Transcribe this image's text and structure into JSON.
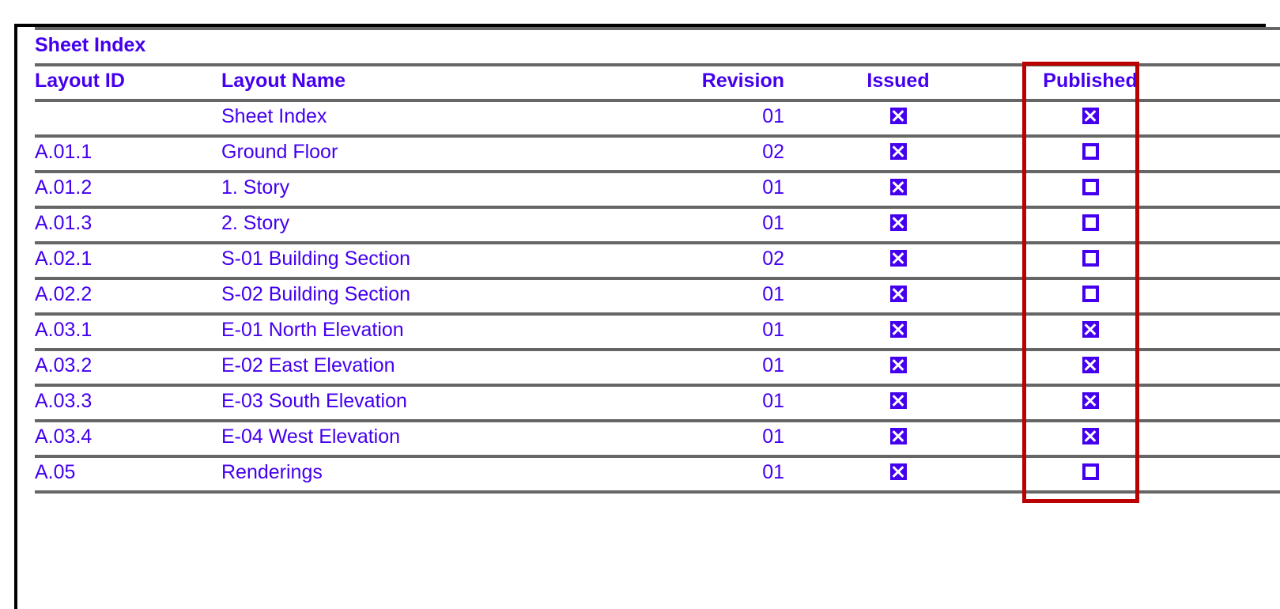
{
  "document": {
    "title": "Sheet Index"
  },
  "table": {
    "columns": [
      {
        "key": "layout_id",
        "label": "Layout ID"
      },
      {
        "key": "layout_name",
        "label": "Layout Name"
      },
      {
        "key": "revision",
        "label": "Revision"
      },
      {
        "key": "issued",
        "label": "Issued"
      },
      {
        "key": "published",
        "label": "Published"
      }
    ],
    "rows": [
      {
        "layout_id": "",
        "layout_name": "Sheet Index",
        "revision": "01",
        "issued": true,
        "published": true
      },
      {
        "layout_id": "A.01.1",
        "layout_name": "Ground Floor",
        "revision": "02",
        "issued": true,
        "published": false
      },
      {
        "layout_id": "A.01.2",
        "layout_name": "1. Story",
        "revision": "01",
        "issued": true,
        "published": false
      },
      {
        "layout_id": "A.01.3",
        "layout_name": "2. Story",
        "revision": "01",
        "issued": true,
        "published": false
      },
      {
        "layout_id": "A.02.1",
        "layout_name": "S-01 Building Section",
        "revision": "02",
        "issued": true,
        "published": false
      },
      {
        "layout_id": "A.02.2",
        "layout_name": "S-02 Building Section",
        "revision": "01",
        "issued": true,
        "published": false
      },
      {
        "layout_id": "A.03.1",
        "layout_name": "E-01 North Elevation",
        "revision": "01",
        "issued": true,
        "published": true
      },
      {
        "layout_id": "A.03.2",
        "layout_name": "E-02 East Elevation",
        "revision": "01",
        "issued": true,
        "published": true
      },
      {
        "layout_id": "A.03.3",
        "layout_name": "E-03 South Elevation",
        "revision": "01",
        "issued": true,
        "published": true
      },
      {
        "layout_id": "A.03.4",
        "layout_name": "E-04 West Elevation",
        "revision": "01",
        "issued": true,
        "published": true
      },
      {
        "layout_id": "A.05",
        "layout_name": "Renderings",
        "revision": "01",
        "issued": true,
        "published": false
      }
    ]
  },
  "annotation": {
    "highlight_target": "Published",
    "highlight_color": "#bb0000"
  },
  "colors": {
    "text": "#4400ee",
    "rule": "#666666",
    "frame": "#000000",
    "highlight": "#bb0000",
    "background": "#ffffff"
  }
}
